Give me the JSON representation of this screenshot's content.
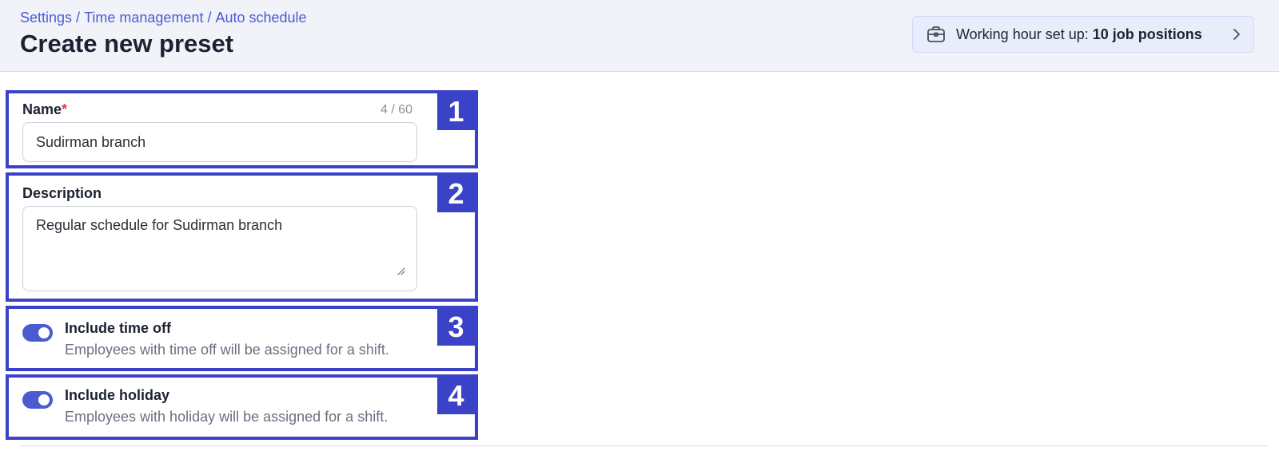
{
  "breadcrumb": {
    "items": [
      "Settings",
      "Time management",
      "Auto schedule"
    ],
    "separator": "/"
  },
  "page_title": "Create new preset",
  "working_hours": {
    "icon": "briefcase-icon",
    "label": "Working hour set up: ",
    "value": "10 job positions"
  },
  "form": {
    "name": {
      "badge": "1",
      "label": "Name",
      "required_mark": "*",
      "counter": "4 / 60",
      "value": "Sudirman branch"
    },
    "description": {
      "badge": "2",
      "label": "Description",
      "value": "Regular schedule for Sudirman branch"
    },
    "include_time_off": {
      "badge": "3",
      "title": "Include time off",
      "description": "Employees with time off will be assigned for a shift.",
      "enabled": true
    },
    "include_holiday": {
      "badge": "4",
      "title": "Include holiday",
      "description": "Employees with holiday will be assigned for a shift.",
      "enabled": true
    }
  },
  "colors": {
    "accent": "#4a5bd0",
    "annotation": "#3a43c7",
    "header_bg": "#f1f3f9",
    "required": "#e03b3b"
  }
}
